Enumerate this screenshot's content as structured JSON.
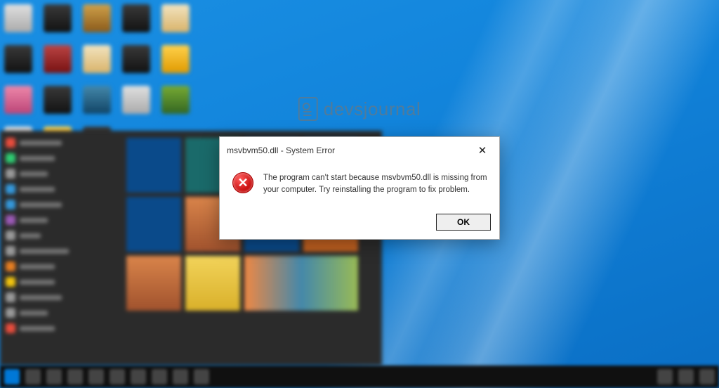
{
  "watermark": {
    "text": "devsjournal"
  },
  "dialog": {
    "title": "msvbvm50.dll - System Error",
    "close_glyph": "✕",
    "icon_glyph": "✕",
    "message": "The program can't start because msvbvm50.dll is missing from your computer. Try reinstalling the program to fix problem.",
    "ok_label": "OK"
  }
}
